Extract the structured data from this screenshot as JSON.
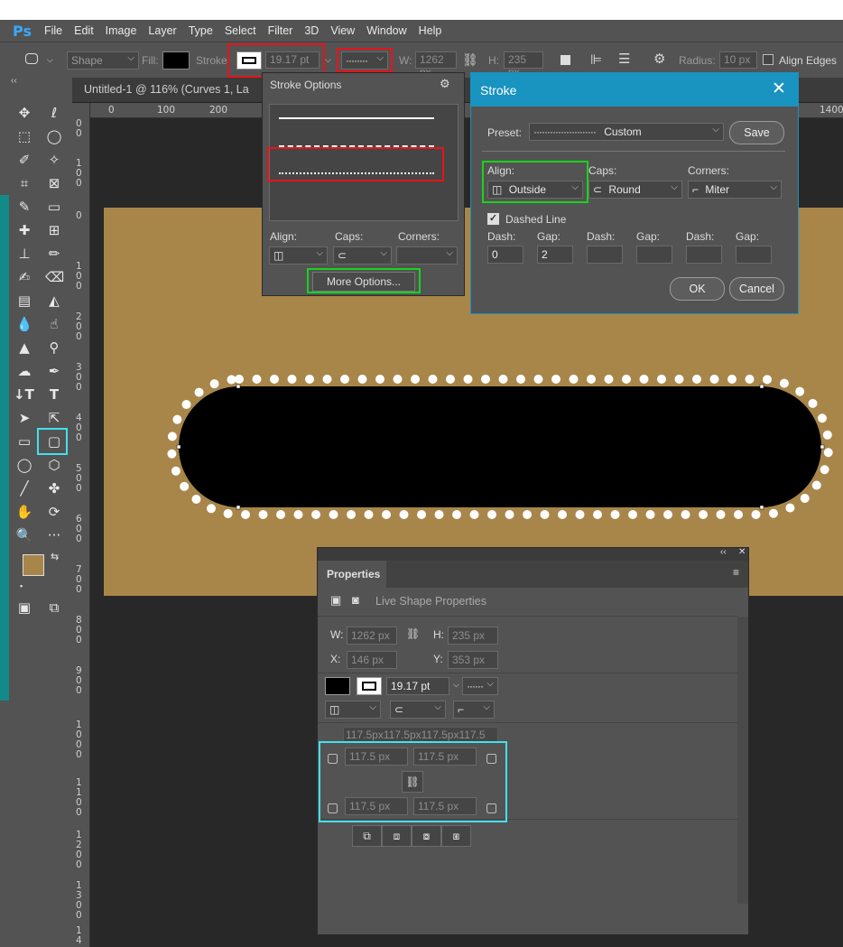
{
  "app": {
    "logo": "Ps"
  },
  "menu": [
    "File",
    "Edit",
    "Image",
    "Layer",
    "Type",
    "Select",
    "Filter",
    "3D",
    "View",
    "Window",
    "Help"
  ],
  "options_bar": {
    "tool_mode": "Shape",
    "fill_label": "Fill:",
    "stroke_label": "Stroke:",
    "stroke_width": "19.17 pt",
    "w_label": "W:",
    "w_value": "1262 px",
    "h_label": "H:",
    "h_value": "235 px",
    "radius_label": "Radius:",
    "radius_value": "10 px",
    "align_edges": "Align Edges"
  },
  "document_tab": "Untitled-1 @ 116% (Curves 1, La",
  "ruler": {
    "h_ticks": [
      "0",
      "100",
      "200",
      "1400"
    ],
    "v_ticks": [
      [
        "0",
        "0"
      ],
      [
        "1",
        "0",
        "0"
      ],
      [
        "0"
      ],
      [
        "1",
        "0",
        "0"
      ],
      [
        "2",
        "0",
        "0"
      ],
      [
        "3",
        "0",
        "0"
      ],
      [
        "4",
        "0",
        "0"
      ],
      [
        "5",
        "0",
        "0"
      ],
      [
        "6",
        "0",
        "0"
      ],
      [
        "7",
        "0",
        "0"
      ],
      [
        "8",
        "0",
        "0"
      ],
      [
        "9",
        "0",
        "0"
      ],
      [
        "1",
        "0",
        "0",
        "0"
      ],
      [
        "1",
        "1",
        "0",
        "0"
      ],
      [
        "1",
        "2",
        "0",
        "0"
      ],
      [
        "1",
        "3",
        "0",
        "0"
      ],
      [
        "1",
        "4"
      ]
    ]
  },
  "stroke_options": {
    "title": "Stroke Options",
    "align_label": "Align:",
    "caps_label": "Caps:",
    "corners_label": "Corners:",
    "more_options": "More Options..."
  },
  "stroke_dialog": {
    "title": "Stroke",
    "preset_label": "Preset:",
    "preset_value": "Custom",
    "save": "Save",
    "align_label": "Align:",
    "align_value": "Outside",
    "caps_label": "Caps:",
    "caps_value": "Round",
    "corners_label": "Corners:",
    "corners_value": "Miter",
    "dashed_line": "Dashed Line",
    "dash_labels": [
      "Dash:",
      "Gap:",
      "Dash:",
      "Gap:",
      "Dash:",
      "Gap:"
    ],
    "dash_values": [
      "0",
      "2",
      "",
      "",
      "",
      ""
    ],
    "ok": "OK",
    "cancel": "Cancel"
  },
  "properties": {
    "tab": "Properties",
    "header": "Live Shape Properties",
    "w_label": "W:",
    "w_value": "1262 px",
    "h_label": "H:",
    "h_value": "235 px",
    "x_label": "X:",
    "x_value": "146 px",
    "y_label": "Y:",
    "y_value": "353 px",
    "stroke_width": "19.17 pt",
    "radii_summary": "117.5px117.5px117.5px117.5",
    "radius_tl": "117.5 px",
    "radius_tr": "117.5 px",
    "radius_bl": "117.5 px",
    "radius_br": "117.5 px"
  },
  "colors": {
    "accent": "#1993bf",
    "canvas": "#a8864a",
    "highlight_red": "#e8131a",
    "highlight_green": "#19d31d",
    "highlight_cyan": "#43e0f0"
  }
}
